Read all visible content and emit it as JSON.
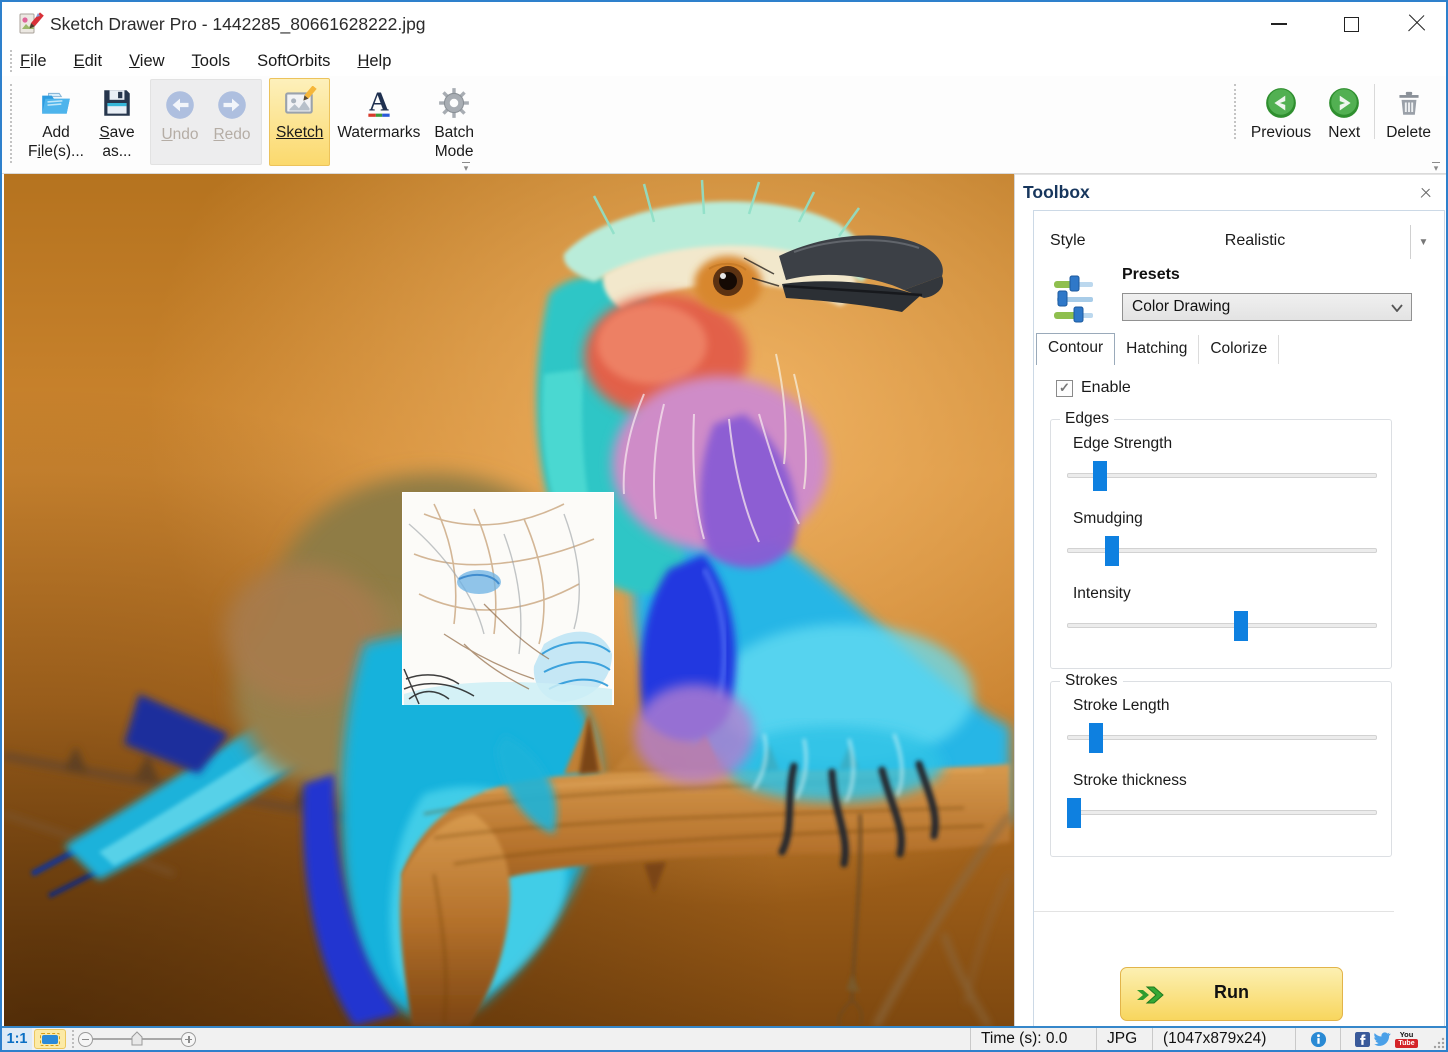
{
  "window": {
    "title": "Sketch Drawer Pro - 1442285_80661628222.jpg"
  },
  "menu": {
    "items": [
      {
        "label": "File",
        "accel": 0
      },
      {
        "label": "Edit",
        "accel": 0
      },
      {
        "label": "View",
        "accel": 0
      },
      {
        "label": "Tools",
        "accel": 0
      },
      {
        "label": "SoftOrbits",
        "accel": -1
      },
      {
        "label": "Help",
        "accel": 0
      }
    ]
  },
  "toolbar": {
    "groups": [
      {
        "style": "plain",
        "buttons": [
          {
            "id": "add-files",
            "lines": [
              {
                "text": "Add",
                "accel": -1
              },
              {
                "text": "File(s)...",
                "accel": 1
              }
            ]
          },
          {
            "id": "save-as",
            "lines": [
              {
                "text": "Save",
                "accel": 0
              },
              {
                "text": "as...",
                "accel": -1
              }
            ]
          }
        ]
      },
      {
        "style": "inset",
        "buttons": [
          {
            "id": "undo",
            "disabled": true,
            "lines": [
              {
                "text": "Undo",
                "accel": 0
              }
            ]
          },
          {
            "id": "redo",
            "disabled": true,
            "lines": [
              {
                "text": "Redo",
                "accel": 0
              }
            ]
          }
        ]
      },
      {
        "style": "plain",
        "buttons": [
          {
            "id": "sketch",
            "active": true,
            "underline_full": true,
            "lines": [
              {
                "text": "Sketch",
                "accel": -1
              }
            ]
          },
          {
            "id": "watermarks",
            "lines": [
              {
                "text": "Watermarks",
                "accel": -1
              }
            ]
          },
          {
            "id": "batch-mode",
            "lines": [
              {
                "text": "Batch",
                "accel": -1
              },
              {
                "text": "Mode",
                "accel": -1
              }
            ]
          }
        ]
      }
    ],
    "right_buttons": [
      {
        "id": "previous",
        "lines": [
          {
            "text": "Previous",
            "accel": -1
          }
        ]
      },
      {
        "id": "next",
        "lines": [
          {
            "text": "Next",
            "accel": -1
          }
        ]
      },
      {
        "id": "delete",
        "sep_before": true,
        "lines": [
          {
            "text": "Delete",
            "accel": -1
          }
        ]
      }
    ]
  },
  "toolbox": {
    "title": "Toolbox",
    "style_label": "Style",
    "style_value": "Realistic",
    "presets_label": "Presets",
    "presets_value": "Color Drawing",
    "tabs": [
      {
        "label": "Contour",
        "active": true
      },
      {
        "label": "Hatching",
        "active": false
      },
      {
        "label": "Colorize",
        "active": false
      }
    ],
    "enable_label": "Enable",
    "enable_checked": true,
    "check_glyph": "✓",
    "groups": [
      {
        "title": "Edges",
        "sliders": [
          {
            "label": "Edge Strength",
            "percent": 11
          },
          {
            "label": "Smudging",
            "percent": 15
          },
          {
            "label": "Intensity",
            "percent": 56
          }
        ]
      },
      {
        "title": "Strokes",
        "sliders": [
          {
            "label": "Stroke Length",
            "percent": 10
          },
          {
            "label": "Stroke thickness",
            "percent": 3
          }
        ]
      }
    ],
    "run_label": "Run"
  },
  "statusbar": {
    "scale_label": "1:1",
    "time_label": "Time (s): 0.0",
    "format_label": "JPG",
    "dimensions_label": "(1047x879x24)",
    "youtube_top": "You",
    "youtube_bottom": "Tube"
  },
  "accent_colors": {
    "window_border": "#2e80cc",
    "slider_thumb": "#0e80e0",
    "run_button": "#f8d65e",
    "sketch_highlight": "#fbd96d",
    "toolbox_title": "#17365d"
  }
}
